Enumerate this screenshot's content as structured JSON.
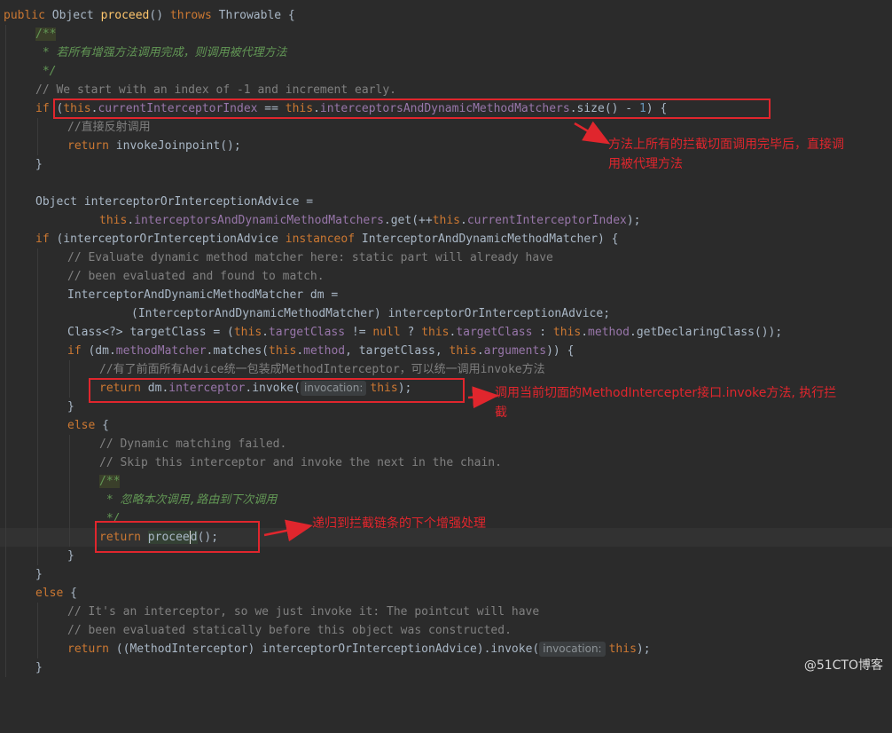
{
  "code": {
    "l0": {
      "kw1": "public",
      "t1": " Object ",
      "m1": "proceed",
      "t2": "() ",
      "kw2": "throws",
      "t3": " Throwable {"
    },
    "l1": {
      "d1": "/**"
    },
    "l2": {
      "d1": " * 若所有增强方法调用完成，则调用被代理方法"
    },
    "l3": {
      "d1": " */"
    },
    "l4": {
      "c1": "// We start with an index of -1 and increment early."
    },
    "l5": {
      "kw1": "if",
      "t1": " (",
      "kw2": "this",
      "t2": ".",
      "f1": "currentInterceptorIndex",
      "t3": " == ",
      "kw3": "this",
      "t4": ".",
      "f2": "interceptorsAndDynamicMethodMatchers",
      "t5": ".size() - ",
      "n1": "1",
      "t6": ") {"
    },
    "l6": {
      "c1": "//直接反射调用"
    },
    "l7": {
      "kw1": "return",
      "t1": " invokeJoinpoint();"
    },
    "l8": {
      "t1": "}"
    },
    "l10": {
      "t1": "Object interceptorOrInterceptionAdvice ="
    },
    "l11": {
      "kw1": "this",
      "t1": ".",
      "f1": "interceptorsAndDynamicMethodMatchers",
      "t2": ".get(++",
      "kw2": "this",
      "t3": ".",
      "f2": "currentInterceptorIndex",
      "t4": ");"
    },
    "l12": {
      "kw1": "if",
      "t1": " (interceptorOrInterceptionAdvice ",
      "kw2": "instanceof",
      "t2": " InterceptorAndDynamicMethodMatcher) {"
    },
    "l13": {
      "c1": "// Evaluate dynamic method matcher here: static part will already have"
    },
    "l14": {
      "c1": "// been evaluated and found to match."
    },
    "l15": {
      "t1": "InterceptorAndDynamicMethodMatcher dm ="
    },
    "l16": {
      "t1": "(InterceptorAndDynamicMethodMatcher) interceptorOrInterceptionAdvice;"
    },
    "l17": {
      "t1": "Class<?> targetClass = (",
      "kw1": "this",
      "t2": ".",
      "f1": "targetClass",
      "t3": " != ",
      "kw2": "null",
      "t4": " ? ",
      "kw3": "this",
      "t5": ".",
      "f2": "targetClass",
      "t6": " : ",
      "kw4": "this",
      "t7": ".",
      "f3": "method",
      "t8": ".getDeclaringClass());"
    },
    "l18": {
      "kw1": "if",
      "t1": " (dm.",
      "f1": "methodMatcher",
      "t2": ".matches(",
      "kw2": "this",
      "t3": ".",
      "f2": "method",
      "t4": ", targetClass, ",
      "kw3": "this",
      "t5": ".",
      "f3": "arguments",
      "t6": ")) {"
    },
    "l19": {
      "c1": "//有了前面所有Advice统一包装成MethodInterceptor，可以统一调用invoke方法"
    },
    "l20": {
      "kw1": "return",
      "t1": " dm.",
      "f1": "interceptor",
      "t2": ".invoke(",
      "h1": "invocation:",
      "kw2": "this",
      "t3": ");"
    },
    "l21": {
      "t1": "}"
    },
    "l22": {
      "kw1": "else",
      "t1": " {"
    },
    "l23": {
      "c1": "// Dynamic matching failed."
    },
    "l24": {
      "c1": "// Skip this interceptor and invoke the next in the chain."
    },
    "l25": {
      "d1": "/**"
    },
    "l26": {
      "d1": " * 忽略本次调用,路由到下次调用"
    },
    "l27": {
      "d1": " */"
    },
    "l28": {
      "kw1": "return",
      "t0": " ",
      "m1a": "procee",
      "m1b": "d",
      "t1": "();"
    },
    "l29": {
      "t1": "}"
    },
    "l30": {
      "t1": "}"
    },
    "l31": {
      "kw1": "else",
      "t1": " {"
    },
    "l32": {
      "c1": "// It's an interceptor, so we just invoke it: The pointcut will have"
    },
    "l33": {
      "c1": "// been evaluated statically before this object was constructed."
    },
    "l34": {
      "kw1": "return",
      "t1": " ((MethodInterceptor) interceptorOrInterceptionAdvice).invoke(",
      "h1": "invocation:",
      "kw2": "this",
      "t2": ");"
    },
    "l35": {
      "t1": "}"
    }
  },
  "annotations": {
    "a1_line1": "方法上所有的拦截切面调用完毕后，直接调",
    "a1_line2": "用被代理方法",
    "a2_line1": "调用当前切面的MethodIntercepter接口.invoke方法, 执行拦",
    "a2_line2": "截",
    "a3": "递归到拦截链条的下个增强处理"
  },
  "watermark": "@51CTO博客",
  "colors": {
    "keyword": "#cc7832",
    "field": "#9876aa",
    "method": "#ffc66d",
    "comment": "#808080",
    "doc": "#629755",
    "annotation": "#e0262d"
  }
}
